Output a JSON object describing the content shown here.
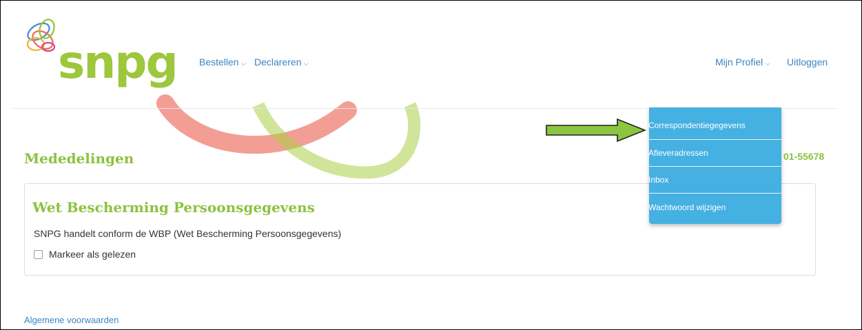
{
  "brand": {
    "name": "snpg",
    "color": "#9dc73c"
  },
  "nav": {
    "left": [
      {
        "label": "Bestellen",
        "icon": "chevron-down-icon"
      },
      {
        "label": "Declareren",
        "icon": "chevron-down-icon"
      }
    ],
    "right": [
      {
        "label": "Mijn Profiel",
        "icon": "chevron-down-icon"
      },
      {
        "label": "Uitloggen"
      }
    ]
  },
  "profile_menu": {
    "items": [
      "Correspondentiegegevens",
      "Afleveradressen",
      "Inbox",
      "Wachtwoord wijzigen"
    ],
    "color": "#45b0e2"
  },
  "main": {
    "heading": "Mededelingen",
    "phone_partial": "01-55678",
    "notice": {
      "title": "Wet Bescherming Persoonsgegevens",
      "body": "SNPG handelt conform de WBP (Wet Bescherming Persoonsgegevens)",
      "checkbox_label": "Markeer als gelezen",
      "checked": false
    }
  },
  "footer": {
    "link": "Algemene voorwaarden"
  },
  "annotation": {
    "icon": "green-arrow-icon",
    "color": "#8cc540"
  }
}
